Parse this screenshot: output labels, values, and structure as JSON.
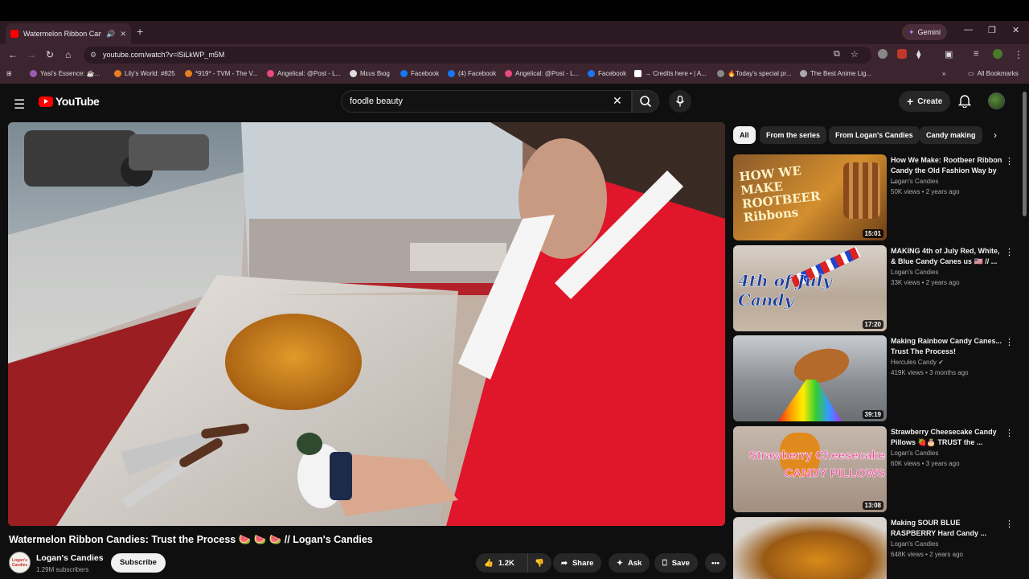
{
  "browser": {
    "tab_title": "Watermelon Ribbon Candi",
    "new_tab": "+",
    "gemini_label": "Gemini",
    "url": "youtube.com/watch?v=lSiLkWP_m5M",
    "bookmarks": [
      {
        "label": "Yasi's Essence: ☕...",
        "color": "#9b59b6"
      },
      {
        "label": "Lily's World: #825",
        "color": "#e67e22"
      },
      {
        "label": "*919* - TVM - The V...",
        "color": "#e67e22"
      },
      {
        "label": "Angelical: @Post - L...",
        "color": "#e84a7a"
      },
      {
        "label": "Mευs Βιοg",
        "color": "#dddddd"
      },
      {
        "label": "Facebook",
        "color": "#1877f2"
      },
      {
        "label": "(4) Facebook",
        "color": "#1877f2"
      },
      {
        "label": "Angelical: @Post - L...",
        "color": "#e84a7a"
      },
      {
        "label": "Facebook",
        "color": "#1877f2"
      },
      {
        "label": "→ Credits here • | A...",
        "color": "#ffffff"
      },
      {
        "label": "🔥Today's special pr...",
        "color": "#888888"
      },
      {
        "label": "The Best Anime Lig...",
        "color": "#aaaaaa"
      }
    ],
    "all_bookmarks": "All Bookmarks"
  },
  "youtube": {
    "logo_text": "YouTube",
    "search_query": "foodle beauty",
    "create_label": "Create",
    "video": {
      "title": "Watermelon Ribbon Candies: Trust the Process 🍉 🍉 🍉 // Logan's Candies",
      "channel": "Logan's Candies",
      "subscribers": "1.29M subscribers",
      "subscribe_label": "Subscribe",
      "likes": "1.2K",
      "share_label": "Share",
      "ask_label": "Ask",
      "save_label": "Save"
    },
    "chips": [
      "All",
      "From the series",
      "From Logan's Candies",
      "Candy making"
    ],
    "recommendations": [
      {
        "title": "How We Make: Rootbeer Ribbon Candy the Old Fashion Way by ...",
        "channel": "Logan's Candies",
        "meta": "50K views • 2 years ago",
        "duration": "15:01",
        "thumb_text": "HOW WE MAKE ROOTBEER Ribbons"
      },
      {
        "title": "MAKING 4th of July Red, White, & Blue Candy Canes us 🇺🇸 // ...",
        "channel": "Logan's Candies",
        "meta": "33K views • 2 years ago",
        "duration": "17:20",
        "thumb_text": "4th of July Candy"
      },
      {
        "title": "Making Rainbow Candy Canes... Trust The Process!",
        "channel": "Hercules Candy ✔",
        "meta": "419K views • 3 months ago",
        "duration": "39:19",
        "thumb_text": ""
      },
      {
        "title": "Strawberry Cheesecake Candy Pillows 🍓🎂 TRUST the ...",
        "channel": "Logan's Candies",
        "meta": "60K views • 3 years ago",
        "duration": "13:08",
        "thumb_text": "Strawberry Cheesecake CANDY PILLOWS"
      },
      {
        "title": "Making SOUR BLUE RASPBERRY Hard Candy ...",
        "channel": "Logan's Candies",
        "meta": "648K views • 2 years ago",
        "duration": "",
        "thumb_text": ""
      }
    ]
  }
}
